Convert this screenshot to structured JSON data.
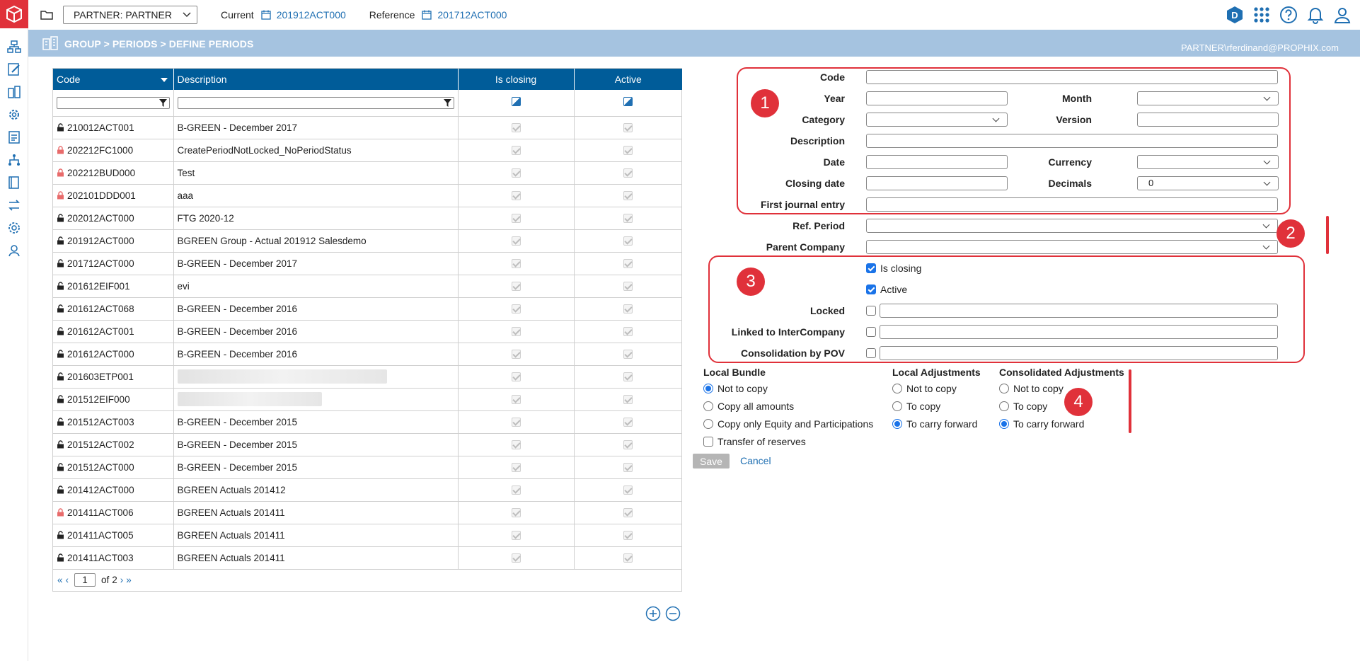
{
  "topbar": {
    "partner": "PARTNER: PARTNER",
    "current_label": "Current",
    "current_value": "201912ACT000",
    "reference_label": "Reference",
    "reference_value": "201712ACT000",
    "badge": "D"
  },
  "band": {
    "breadcrumb": "GROUP > PERIODS > DEFINE PERIODS",
    "user": "PARTNER\\rferdinand@PROPHIX.com"
  },
  "grid": {
    "columns": {
      "code": "Code",
      "description": "Description",
      "is_closing": "Is closing",
      "active": "Active"
    },
    "rows": [
      {
        "code": "210012ACT001",
        "description": "B-GREEN - December 2017",
        "locked": false
      },
      {
        "code": "202212FC1000",
        "description": "CreatePeriodNotLocked_NoPeriodStatus",
        "locked": true
      },
      {
        "code": "202212BUD000",
        "description": "Test",
        "locked": true
      },
      {
        "code": "202101DDD001",
        "description": "aaa",
        "locked": true
      },
      {
        "code": "202012ACT000",
        "description": "FTG 2020-12",
        "locked": false
      },
      {
        "code": "201912ACT000",
        "description": "BGREEN Group - Actual 201912 Salesdemo",
        "locked": false
      },
      {
        "code": "201712ACT000",
        "description": "B-GREEN - December 2017",
        "locked": false
      },
      {
        "code": "201612EIF001",
        "description": "evi",
        "locked": false
      },
      {
        "code": "201612ACT068",
        "description": "B-GREEN - December 2016",
        "locked": false
      },
      {
        "code": "201612ACT001",
        "description": "B-GREEN - December 2016",
        "locked": false
      },
      {
        "code": "201612ACT000",
        "description": "B-GREEN - December 2016",
        "locked": false
      },
      {
        "code": "201603ETP001",
        "description": "",
        "locked": false,
        "blurred": true
      },
      {
        "code": "201512EIF000",
        "description": "",
        "locked": false,
        "blurred": true
      },
      {
        "code": "201512ACT003",
        "description": "B-GREEN - December 2015",
        "locked": false
      },
      {
        "code": "201512ACT002",
        "description": "B-GREEN - December 2015",
        "locked": false
      },
      {
        "code": "201512ACT000",
        "description": "B-GREEN - December 2015",
        "locked": false
      },
      {
        "code": "201412ACT000",
        "description": "BGREEN Actuals 201412",
        "locked": false
      },
      {
        "code": "201411ACT006",
        "description": "BGREEN Actuals 201411",
        "locked": true
      },
      {
        "code": "201411ACT005",
        "description": "BGREEN Actuals 201411",
        "locked": false
      },
      {
        "code": "201411ACT003",
        "description": "BGREEN Actuals 201411",
        "locked": false
      }
    ],
    "pager": {
      "page": "1",
      "of_label": "of",
      "total": "2"
    }
  },
  "form": {
    "labels": {
      "code": "Code",
      "year": "Year",
      "month": "Month",
      "category": "Category",
      "version": "Version",
      "description": "Description",
      "date": "Date",
      "currency": "Currency",
      "closing_date": "Closing date",
      "decimals": "Decimals",
      "first_journal_entry": "First journal entry",
      "ref_period": "Ref. Period",
      "parent_company": "Parent Company",
      "locked": "Locked",
      "linked_interco": "Linked to InterCompany",
      "consolidation_pov": "Consolidation by POV"
    },
    "decimals_value": "0",
    "is_closing_label": "Is closing",
    "active_label": "Active",
    "callouts": [
      "1",
      "2",
      "3",
      "4"
    ]
  },
  "copy_options": {
    "local_bundle": {
      "title": "Local Bundle",
      "options": [
        "Not to copy",
        "Copy all amounts",
        "Copy only Equity and Participations"
      ]
    },
    "transfer_label": "Transfer of reserves",
    "local_adjustments": {
      "title": "Local Adjustments",
      "options": [
        "Not to copy",
        "To copy",
        "To carry forward"
      ]
    },
    "consolidated_adjustments": {
      "title": "Consolidated Adjustments",
      "options": [
        "Not to copy",
        "To copy",
        "To carry forward"
      ]
    }
  },
  "actions": {
    "save": "Save",
    "cancel": "Cancel"
  },
  "colors": {
    "brand": "#e0313a",
    "header_blue": "#005c99",
    "band": "#a5c3e0",
    "link": "#1f6fb2"
  }
}
